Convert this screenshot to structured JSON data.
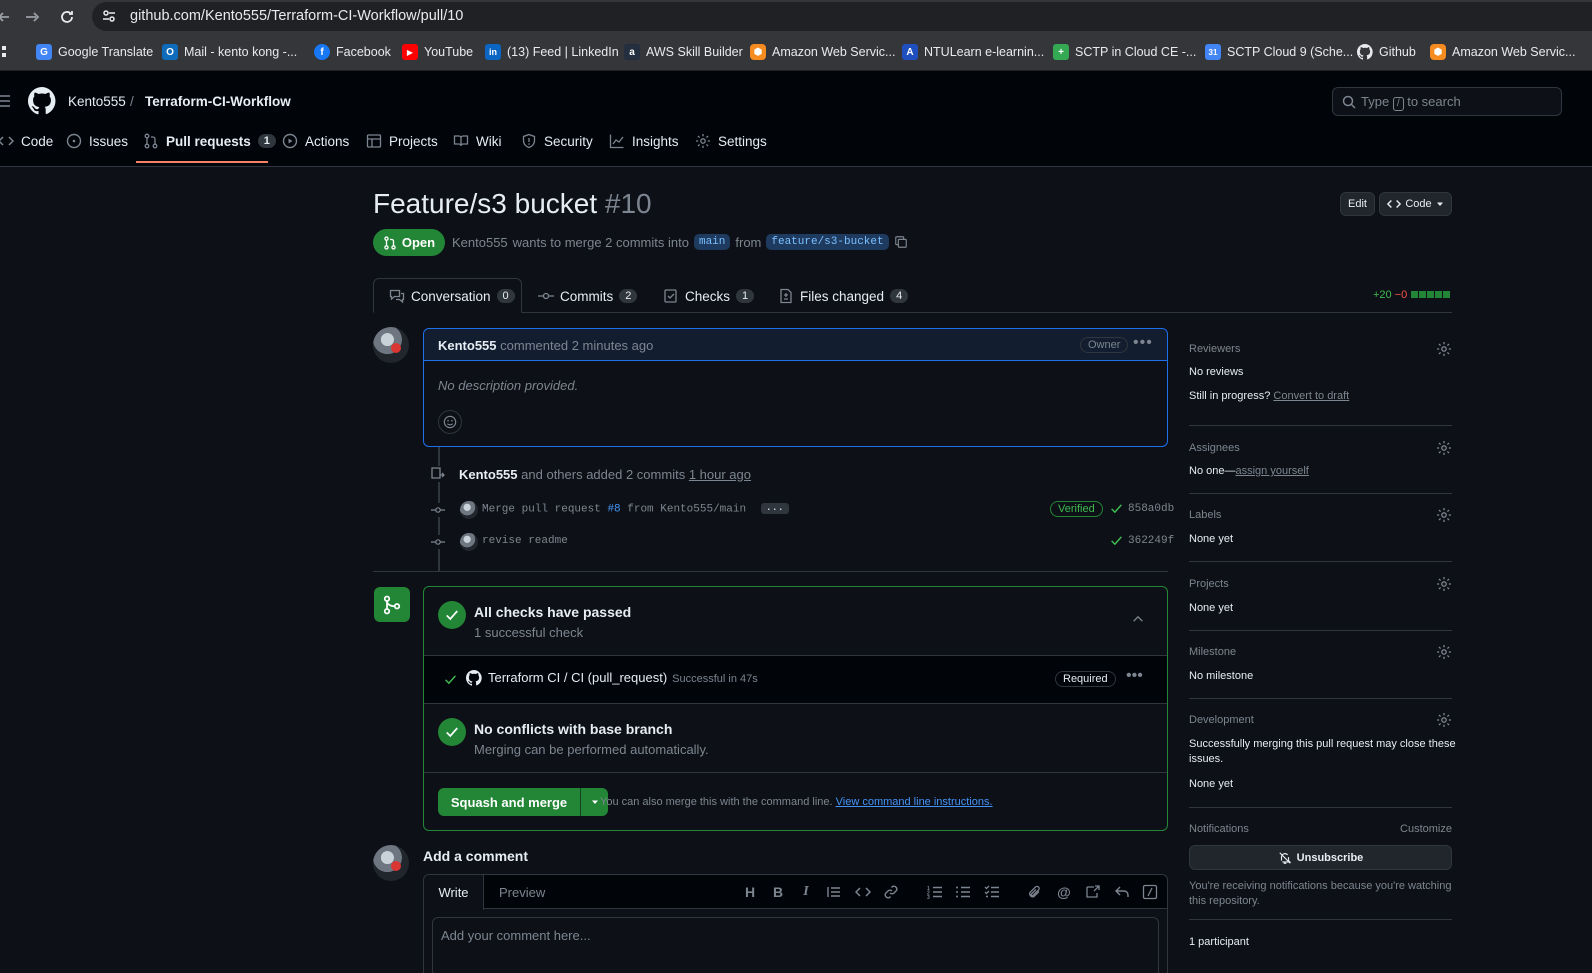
{
  "browser": {
    "url": "github.com/Kento555/Terraform-CI-Workflow/pull/10",
    "bookmarks": [
      {
        "label": "Google Translate",
        "color": "#4285f4",
        "glyph": "G"
      },
      {
        "label": "Mail - kento kong -...",
        "color": "#0f6cbd",
        "glyph": "O"
      },
      {
        "label": "Facebook",
        "color": "#1877f2",
        "glyph": "f"
      },
      {
        "label": "YouTube",
        "color": "#ff0000",
        "glyph": "▶"
      },
      {
        "label": "(13) Feed | LinkedIn",
        "color": "#0a66c2",
        "glyph": "in"
      },
      {
        "label": "AWS Skill Builder",
        "color": "#232f3e",
        "glyph": "a"
      },
      {
        "label": "Amazon Web Servic...",
        "color": "#f68b1f",
        "glyph": "⬢"
      },
      {
        "label": "NTULearn e-learnin...",
        "color": "#1f4fbf",
        "glyph": "A"
      },
      {
        "label": "SCTP in Cloud CE -...",
        "color": "#34a853",
        "glyph": "+"
      },
      {
        "label": "SCTP Cloud 9 (Sche...",
        "color": "#4285f4",
        "glyph": "31"
      },
      {
        "label": "Github",
        "color": "#0d1117",
        "glyph": "●"
      },
      {
        "label": "Amazon Web Servic...",
        "color": "#f68b1f",
        "glyph": "⬢"
      }
    ]
  },
  "header": {
    "owner": "Kento555",
    "separator": "/",
    "repo": "Terraform-CI-Workflow",
    "search_prefix": "Type",
    "search_key": "/",
    "search_suffix": "to search"
  },
  "repo_tabs": [
    {
      "label": "Code"
    },
    {
      "label": "Issues"
    },
    {
      "label": "Pull requests",
      "count": "1"
    },
    {
      "label": "Actions"
    },
    {
      "label": "Projects"
    },
    {
      "label": "Wiki"
    },
    {
      "label": "Security"
    },
    {
      "label": "Insights"
    },
    {
      "label": "Settings"
    }
  ],
  "pr": {
    "title": "Feature/s3 bucket",
    "number": "#10",
    "edit_label": "Edit",
    "code_label": "Code",
    "state": "Open",
    "author": "Kento555",
    "merge_text": "wants to merge 2 commits into",
    "base": "main",
    "from_text": "from",
    "head": "feature/s3-bucket"
  },
  "pr_tabs": [
    {
      "label": "Conversation",
      "count": "0"
    },
    {
      "label": "Commits",
      "count": "2"
    },
    {
      "label": "Checks",
      "count": "1"
    },
    {
      "label": "Files changed",
      "count": "4"
    }
  ],
  "diffstat": {
    "additions": "+20",
    "deletions": "−0",
    "squares": 5
  },
  "comment": {
    "author": "Kento555",
    "action": "commented 2 minutes ago",
    "badge": "Owner",
    "body": "No description provided."
  },
  "commits": {
    "summary_author": "Kento555",
    "summary_text": "and others added 2 commits",
    "summary_time": "1 hour ago",
    "items": [
      {
        "message": "Merge pull request",
        "ref": "#8",
        "message_tail": "from Kento555/main",
        "has_more": true,
        "more_label": "...",
        "verified": "Verified",
        "sha": "858a0db"
      },
      {
        "message": "revise readme",
        "ref": "",
        "message_tail": "",
        "has_more": false,
        "more_label": "",
        "verified": "",
        "sha": "362249f"
      }
    ]
  },
  "merge_box": {
    "checks_title": "All checks have passed",
    "checks_sub": "1 successful check",
    "check_name": "Terraform CI / CI (pull_request)",
    "check_status": "Successful in 47s",
    "check_badge": "Required",
    "conflicts_title": "No conflicts with base branch",
    "conflicts_sub": "Merging can be performed automatically.",
    "merge_button": "Squash and merge",
    "cli_text": "You can also merge this with the command line.",
    "cli_link": "View command line instructions."
  },
  "add_comment": {
    "title": "Add a comment",
    "tab_write": "Write",
    "tab_preview": "Preview",
    "placeholder": "Add your comment here..."
  },
  "sidebar": {
    "reviewers": {
      "title": "Reviewers",
      "value": "No reviews",
      "progress_text": "Still in progress?",
      "progress_link": "Convert to draft"
    },
    "assignees": {
      "title": "Assignees",
      "value": "No one—",
      "link": "assign yourself"
    },
    "labels": {
      "title": "Labels",
      "value": "None yet"
    },
    "projects": {
      "title": "Projects",
      "value": "None yet"
    },
    "milestone": {
      "title": "Milestone",
      "value": "No milestone"
    },
    "development": {
      "title": "Development",
      "desc_line1": "Successfully merging this pull request may close these",
      "desc_line2": "issues.",
      "value": "None yet"
    },
    "notifications": {
      "title": "Notifications",
      "customize": "Customize",
      "button": "Unsubscribe",
      "note_line1": "You're receiving notifications because you're watching",
      "note_line2": "this repository."
    },
    "participants": "1 participant"
  }
}
